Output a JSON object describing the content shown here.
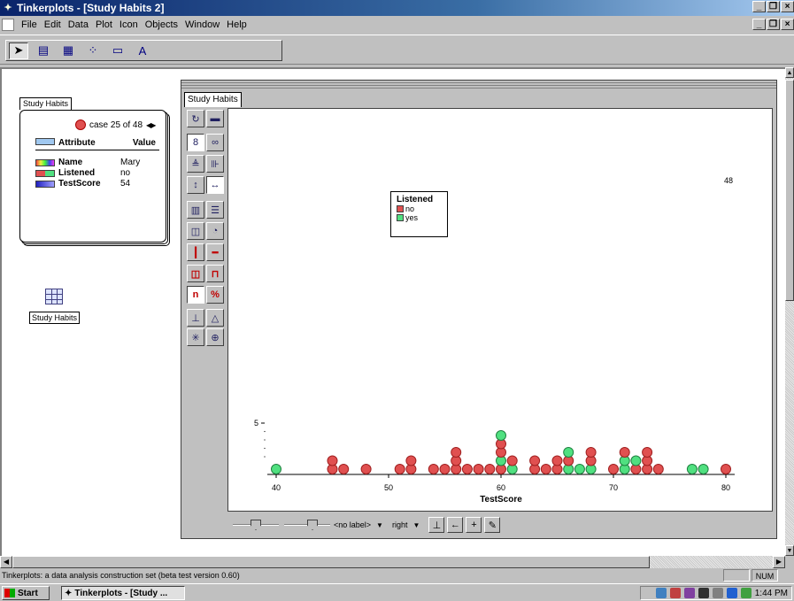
{
  "window": {
    "title": "Tinkerplots - [Study Habits 2]"
  },
  "menu": [
    "File",
    "Edit",
    "Data",
    "Plot",
    "Icon",
    "Objects",
    "Window",
    "Help"
  ],
  "toolbar": {
    "icons": [
      "pointer-icon",
      "card-icon",
      "table-icon",
      "plot-icon",
      "slider-icon",
      "text-icon"
    ]
  },
  "card": {
    "tab_label": "Study Habits",
    "case_text": "case 25 of 48",
    "header_attribute": "Attribute",
    "header_value": "Value",
    "rows": [
      {
        "name": "Name",
        "value": "Mary"
      },
      {
        "name": "Listened",
        "value": "no"
      },
      {
        "name": "TestScore",
        "value": "54"
      }
    ]
  },
  "table_icon": {
    "label": "Study Habits"
  },
  "plot": {
    "tab_label": "Study Habits",
    "count_label": "48",
    "legend": {
      "title": "Listened",
      "items": [
        {
          "label": "no",
          "color": "#e05050"
        },
        {
          "label": "yes",
          "color": "#50e080"
        }
      ]
    },
    "bottom": {
      "label_dropdown": "<no label>",
      "position_dropdown": "right"
    }
  },
  "chart_data": {
    "type": "scatter",
    "xlabel": "TestScore",
    "ylabel": "",
    "xlim": [
      40,
      80
    ],
    "xticks": [
      40,
      50,
      60,
      70,
      80
    ],
    "yticks": [
      5
    ],
    "colors": {
      "no": "#e05050",
      "yes": "#50e080"
    },
    "stacks": [
      {
        "x": 40,
        "dots": [
          "yes"
        ]
      },
      {
        "x": 45,
        "dots": [
          "no",
          "no"
        ]
      },
      {
        "x": 46,
        "dots": [
          "no"
        ]
      },
      {
        "x": 48,
        "dots": [
          "no"
        ]
      },
      {
        "x": 51,
        "dots": [
          "no"
        ]
      },
      {
        "x": 52,
        "dots": [
          "no",
          "no"
        ]
      },
      {
        "x": 54,
        "dots": [
          "no"
        ]
      },
      {
        "x": 55,
        "dots": [
          "no"
        ]
      },
      {
        "x": 56,
        "dots": [
          "no",
          "no",
          "no"
        ]
      },
      {
        "x": 57,
        "dots": [
          "no"
        ]
      },
      {
        "x": 58,
        "dots": [
          "no"
        ]
      },
      {
        "x": 59,
        "dots": [
          "no"
        ]
      },
      {
        "x": 60,
        "dots": [
          "no",
          "yes",
          "no",
          "no",
          "yes"
        ]
      },
      {
        "x": 61,
        "dots": [
          "yes",
          "no"
        ]
      },
      {
        "x": 63,
        "dots": [
          "no",
          "no"
        ]
      },
      {
        "x": 64,
        "dots": [
          "no"
        ]
      },
      {
        "x": 65,
        "dots": [
          "no",
          "no"
        ]
      },
      {
        "x": 66,
        "dots": [
          "yes",
          "no",
          "yes"
        ]
      },
      {
        "x": 67,
        "dots": [
          "yes"
        ]
      },
      {
        "x": 68,
        "dots": [
          "yes",
          "no",
          "no"
        ]
      },
      {
        "x": 70,
        "dots": [
          "no"
        ]
      },
      {
        "x": 71,
        "dots": [
          "yes",
          "yes",
          "no"
        ]
      },
      {
        "x": 72,
        "dots": [
          "no",
          "yes"
        ]
      },
      {
        "x": 73,
        "dots": [
          "no",
          "no",
          "no"
        ]
      },
      {
        "x": 74,
        "dots": [
          "no"
        ]
      },
      {
        "x": 77,
        "dots": [
          "yes"
        ]
      },
      {
        "x": 78,
        "dots": [
          "yes"
        ]
      },
      {
        "x": 80,
        "dots": [
          "no"
        ]
      }
    ]
  },
  "status": {
    "text": "Tinkerplots: a data analysis construction set (beta test version 0.60)",
    "num": "NUM"
  },
  "taskbar": {
    "start": "Start",
    "task": "Tinkerplots - [Study ...",
    "clock": "1:44 PM"
  }
}
